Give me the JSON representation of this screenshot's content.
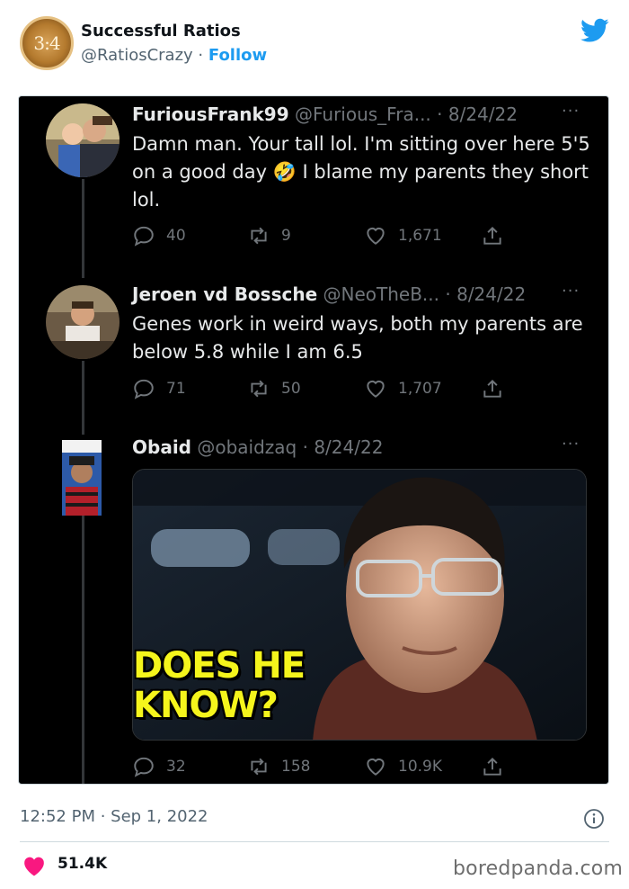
{
  "embed": {
    "avatar_text": "3:4",
    "account_name": "Successful Ratios",
    "handle": "@RatiosCrazy",
    "separator": " · ",
    "follow_label": "Follow",
    "brand_color": "#1d9bf0"
  },
  "thread": [
    {
      "name": "FuriousFrank99",
      "handle": "@Furious_Fra...",
      "date": "8/24/22",
      "text": "Damn man. Your tall lol. I'm sitting over here 5'5 on a good day 🤣 I blame my parents they short lol.",
      "replies": "40",
      "retweets": "9",
      "likes": "1,671"
    },
    {
      "name": "Jeroen vd Bossche",
      "handle": "@NeoTheB...",
      "date": "8/24/22",
      "text": "Genes work in weird ways, both my parents are below 5.8 while I am 6.5",
      "replies": "71",
      "retweets": "50",
      "likes": "1,707"
    },
    {
      "name": "Obaid",
      "handle": "@obaidzaq",
      "date": "8/24/22",
      "text": "",
      "media_caption_line1": "DOES HE",
      "media_caption_line2": "KNOW?",
      "replies": "32",
      "retweets": "158",
      "likes": "10.9K"
    }
  ],
  "more_glyph": "···",
  "meta_separator": " · ",
  "footer": {
    "timestamp": "12:52 PM · Sep 1, 2022",
    "like_count": "51.4K",
    "heart_color": "#f91880",
    "watermark": "boredpanda.com"
  }
}
